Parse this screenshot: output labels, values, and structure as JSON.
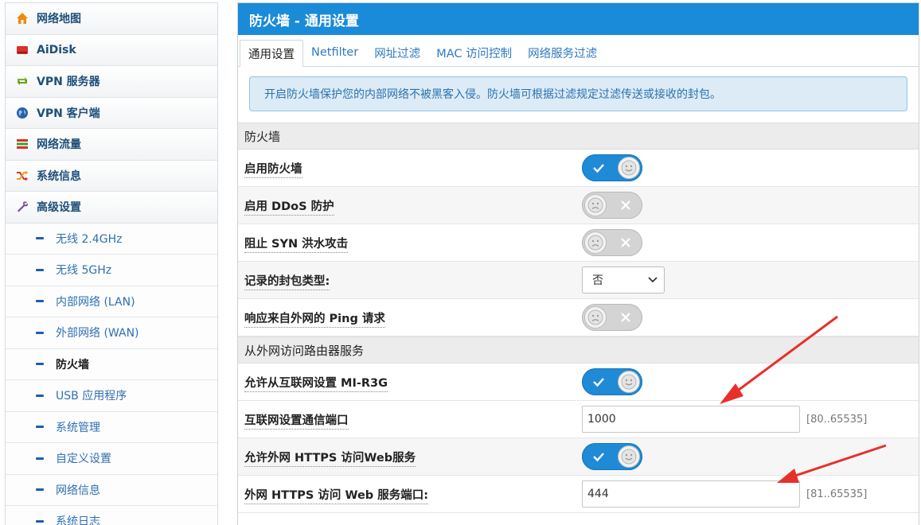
{
  "sidebar": {
    "items": [
      {
        "label": "网络地图",
        "icon": "home-icon"
      },
      {
        "label": "AiDisk",
        "icon": "disk-icon"
      },
      {
        "label": "VPN 服务器",
        "icon": "vpn-server-icon"
      },
      {
        "label": "VPN 客户端",
        "icon": "globe-icon"
      },
      {
        "label": "网络流量",
        "icon": "traffic-icon"
      },
      {
        "label": "系统信息",
        "icon": "shuffle-icon"
      },
      {
        "label": "高级设置",
        "icon": "wrench-icon"
      }
    ],
    "subitems": [
      {
        "label": "无线 2.4GHz"
      },
      {
        "label": "无线 5GHz"
      },
      {
        "label": "内部网络 (LAN)"
      },
      {
        "label": "外部网络 (WAN)"
      },
      {
        "label": "防火墙"
      },
      {
        "label": "USB 应用程序"
      },
      {
        "label": "系统管理"
      },
      {
        "label": "自定义设置"
      },
      {
        "label": "网络信息"
      },
      {
        "label": "系统日志"
      }
    ],
    "active_subitem": "防火墙"
  },
  "panel": {
    "title": "防火墙 - 通用设置",
    "tabs": [
      {
        "label": "通用设置"
      },
      {
        "label": "Netfilter"
      },
      {
        "label": "网址过滤"
      },
      {
        "label": "MAC 访问控制"
      },
      {
        "label": "网络服务过滤"
      }
    ],
    "active_tab": "通用设置",
    "notice": "开启防火墙保护您的内部网络不被黑客入侵。防火墙可根据过滤规定过滤传送或接收的封包。"
  },
  "firewall": {
    "section_title": "防火墙",
    "enable_label": "启用防火墙",
    "enable_on": true,
    "ddos_label": "启用 DDoS 防护",
    "ddos_on": false,
    "syn_label": "阻止 SYN 洪水攻击",
    "syn_on": false,
    "log_label": "记录的封包类型:",
    "log_value": "否",
    "ping_label": "响应来自外网的 Ping 请求",
    "ping_on": false
  },
  "wan_access": {
    "section_title": "从外网访问路由器服务",
    "allow_remote_label": "允许从互联网设置 MI-R3G",
    "allow_remote_on": true,
    "remote_port_label": "互联网设置通信端口",
    "remote_port_value": "1000",
    "remote_port_range": "[80..65535]",
    "https_label": "允许外网 HTTPS 访问Web服务",
    "https_on": true,
    "https_port_label": "外网 HTTPS 访问 Web 服务端口:",
    "https_port_value": "444",
    "https_port_range": "[81..65535]"
  },
  "colors": {
    "header": "#1a8bd8",
    "toggle_on": "#1f8ad6",
    "toggle_off": "#d4d4d4",
    "arrow": "#e8302a",
    "notice_bg": "#dcebf6"
  }
}
